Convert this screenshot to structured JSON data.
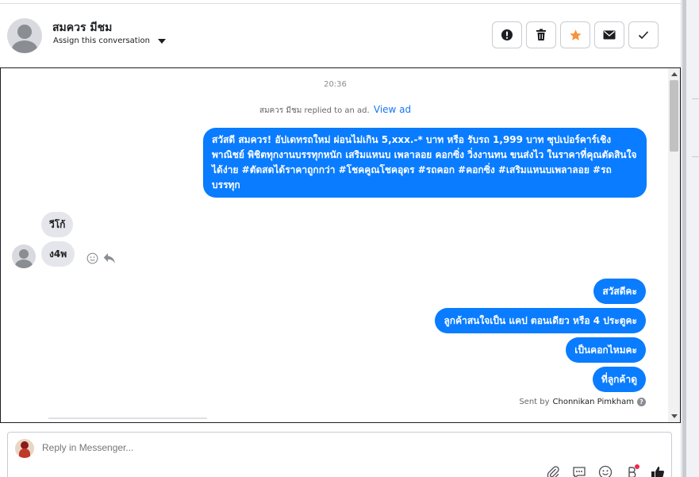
{
  "header": {
    "contact_name": "สมควร มีชม",
    "assign_label": "Assign this conversation",
    "actions": [
      "mark-spam-icon",
      "trash-icon",
      "star-icon",
      "mail-icon",
      "check-icon"
    ],
    "star_color": "#f7923a"
  },
  "conversation": {
    "timestamp": "20:36",
    "ad_reply_text": "สมควร มีชม replied to an ad.",
    "view_ad_label": "View ad",
    "messages": [
      {
        "direction": "outgoing",
        "text": "สวัสดี สมควร! อัปเดทรถใหม่ ผ่อนไม่เกิน 5,xxx.-* บาท  หรือ รับรถ 1,999 บาท ซุปเปอร์คาร์เชิงพาณิชย์ พิชิตทุกงานบรรทุกหนัก เสริมแหนบ เพลาลอย คอกซิ่ง วิ่งงานทน ขนส่งไว ในราคาที่คุณตัดสินใจได้ง่าย #ตัดสดได้ราคาถูกกว่า #โชคคูณโชคอุดร #รถคอก #คอกซิ่ง #เสริมแหนบเพลาลอย #รถบรรทุก"
      },
      {
        "direction": "incoming",
        "text": "วีโก้"
      },
      {
        "direction": "incoming",
        "text": "ง4พ"
      },
      {
        "direction": "outgoing",
        "text": "สวัสดีคะ"
      },
      {
        "direction": "outgoing",
        "text": "ลูกค้าสนใจเป็น แคป ตอนเดียว หรือ 4 ประตูคะ"
      },
      {
        "direction": "outgoing",
        "text": "เป็นคอกไหมคะ"
      },
      {
        "direction": "outgoing",
        "text": "ที่ลูกค้าดู"
      }
    ],
    "sent_by_prefix": "Sent by",
    "sent_by_agent": "Chonnikan Pimkham",
    "help_glyph": "?",
    "outgoing_color": "#0a7cff",
    "incoming_color": "#e4e6eb"
  },
  "reply": {
    "placeholder": "Reply in Messenger...",
    "tools": [
      "paperclip-icon",
      "saved-reply-icon",
      "emoji-icon",
      "payment-icon",
      "thumbs-up-icon"
    ]
  }
}
